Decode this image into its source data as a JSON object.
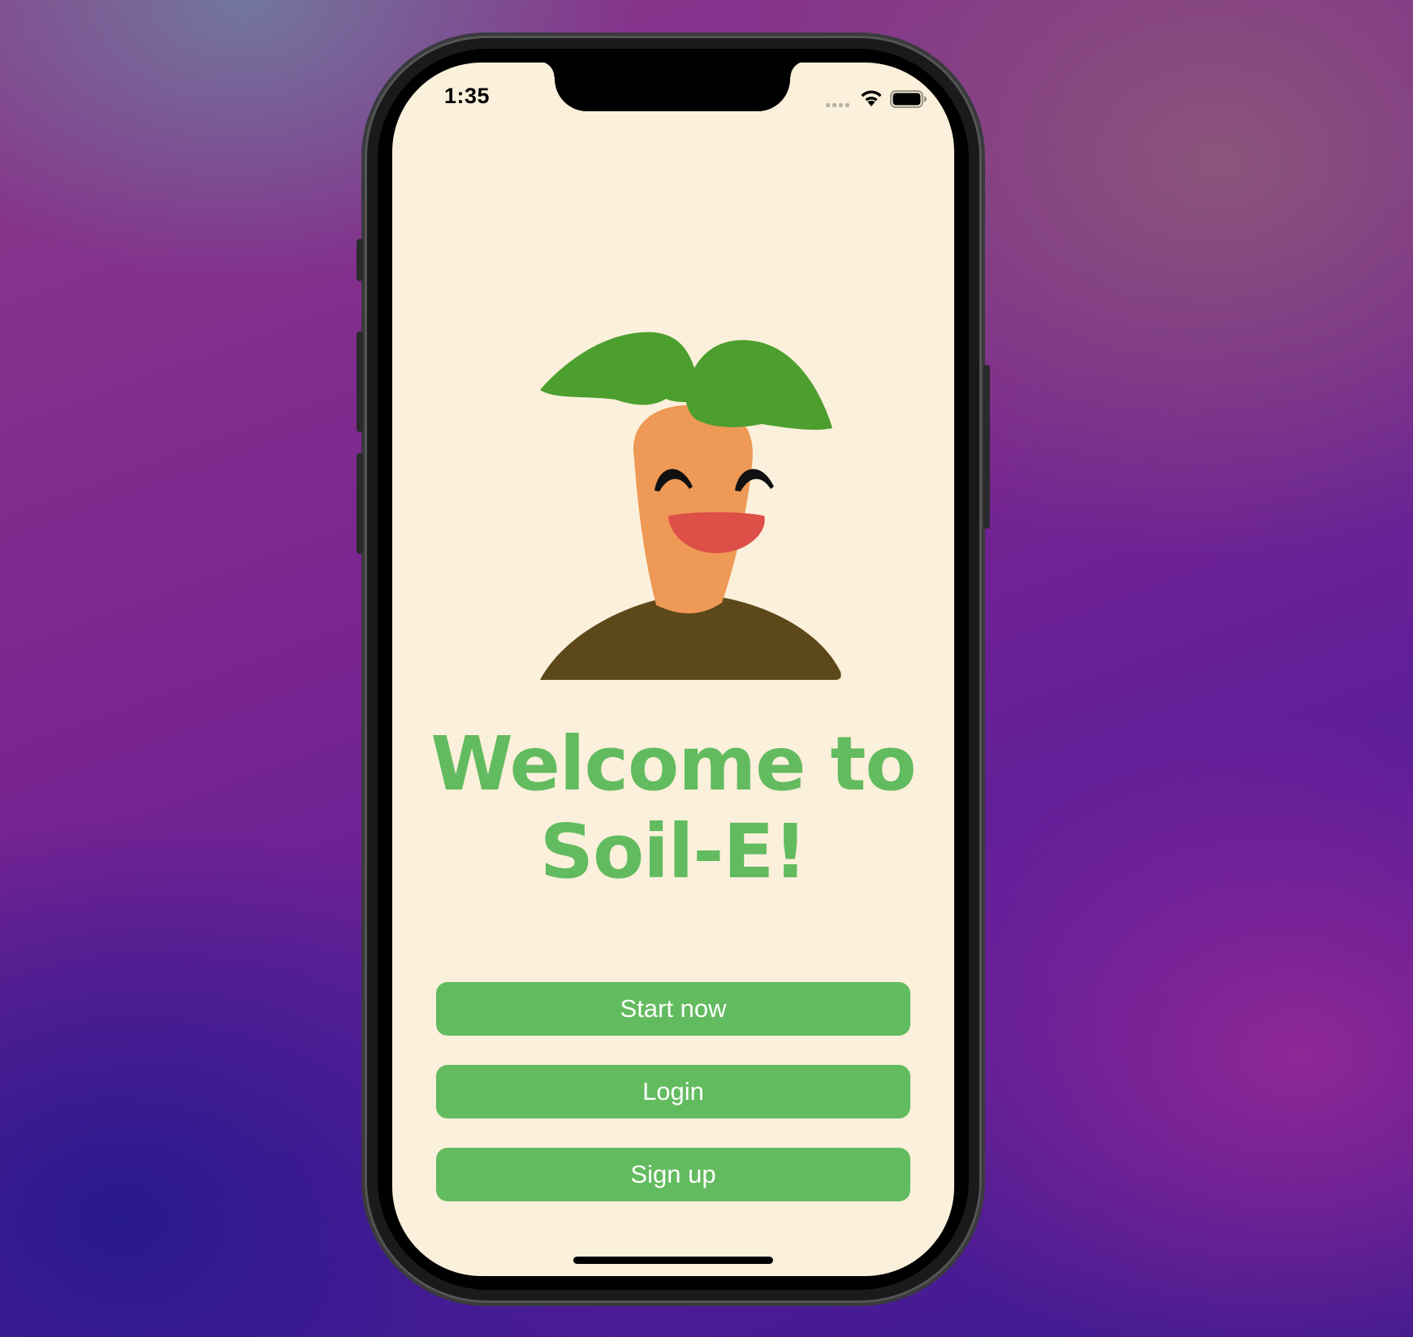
{
  "status_bar": {
    "time": "1:35",
    "signal_icon": "cellular-signal-icon",
    "wifi_icon": "wifi-icon",
    "battery_icon": "battery-icon"
  },
  "mascot": {
    "icon": "carrot-mascot-icon"
  },
  "welcome": {
    "line1": "Welcome to",
    "line2": "Soil-E!"
  },
  "buttons": {
    "start_now": "Start now",
    "login": "Login",
    "sign_up": "Sign up"
  },
  "colors": {
    "background": "#fbf0db",
    "accent_green": "#63bb5f",
    "leaf_green": "#4c9f2f",
    "carrot_orange": "#ee9955",
    "mouth_red": "#dd4f47",
    "soil_brown": "#5c4819"
  }
}
